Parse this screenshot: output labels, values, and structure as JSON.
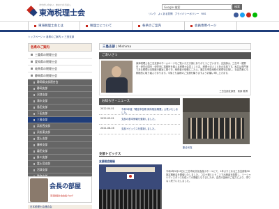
{
  "header": {
    "logo_sub": "まちがいのない、あなたのそばに。",
    "logo_title": "東海税理士会",
    "search_placeholder": "Google 検索",
    "search_button": "検索",
    "util_links": [
      "リンク",
      "よくある質問",
      "プライバシーポリシー",
      "RSS"
    ],
    "sns_colors": [
      "#3b5998",
      "#1da1f2",
      "#c7261a",
      "#00b900"
    ]
  },
  "nav": {
    "items": [
      "東海税理士会とは",
      "税理士について",
      "各県のご案内",
      "会員専用ページ"
    ]
  },
  "breadcrumb": "トップページ > 各県のご案内 > 三島支部",
  "sidebar": {
    "heading": "各県のご案内",
    "items": [
      "三重県の税理士会",
      "愛知県の税理士会",
      "岐阜県の税理士会",
      "静岡県の税理士会"
    ],
    "sub_items": [
      "静岡県支部連合会",
      "静岡支部",
      "沼津支部",
      "清水支部",
      "島田支部",
      "下田支部",
      "三島支部",
      "浜松西支部",
      "浜松東支部",
      "富士支部",
      "藤枝支部",
      "磐田支部",
      "掛川支部",
      "富士宮支部",
      "沼津支部",
      "熱海支部"
    ],
    "active_index": 6,
    "banner_title": "会長の部屋",
    "banner_sub": "東海税理士会会長ブログ",
    "banner2": "日本税理士会連合会"
  },
  "main": {
    "title_prefix": "三島支部",
    "title_suffix": "Mishima",
    "greeting_heading": "ごあいさつ",
    "greeting_text": "東海税理士会三島支部のホームページをご覧いただき誠にありがとうございます。当支部は、三島市・裾野市・伊豆の国市・伊豆市に事務所を構える税理士会員１１８名、税理士法人１０社の支部です。私共は専門家である税理士法制度の趣旨に基づき、納税者の信頼にこたえ、適正な申告納税の実現を目指し、社会貢献にも積極的に取り組んでおります。今後とも皆様のご支援を賜りますようお願い申し上げます。",
    "greeting_sign": "三島支部支部長　萩原 義博",
    "news_heading": "お知らせ・ニュース",
    "news": [
      {
        "date": "2022-04-01",
        "title": "令和3年度「確定申告期 無料相談概要」公表いたしました。"
      },
      {
        "date": "2022-03-01",
        "title": "支部の基本情報を更新しました。"
      },
      {
        "date": "2021-08-16",
        "title": "支部トピックスを更新しました。"
      }
    ],
    "news_photo_caption": "集合写真",
    "topics_heading": "支部トピックス",
    "topic_title": "支部総会開催",
    "topic_text": "令和4年5月18日に三島市民文化会館小ホールにて、1年ぶりとなる三島支部第58回定期総会を開催いたしました。コロナ禍ということで出席者を制限し、ソーシャルディスタンスを保っての開催となりましたが、会員の皆様のご協力により、滞りなく終了いたしました。"
  }
}
